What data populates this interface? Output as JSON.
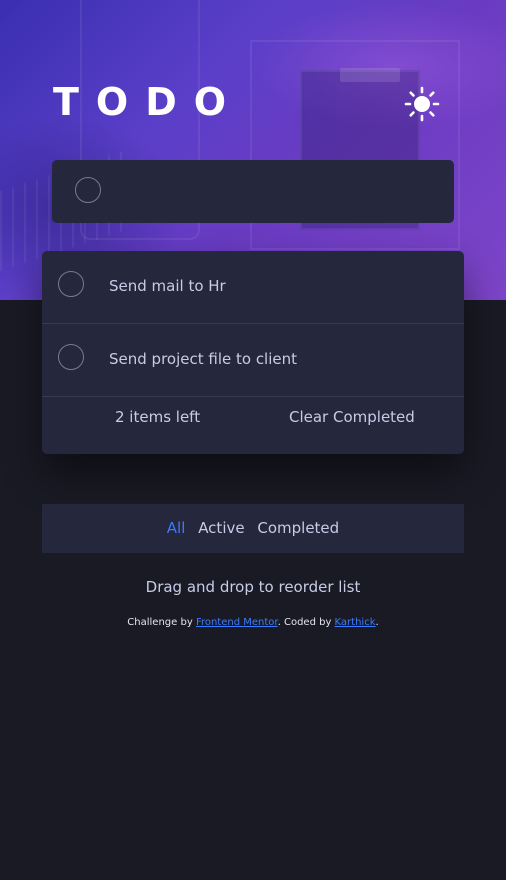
{
  "app": {
    "title": "TODO",
    "theme_icon": "sun-icon"
  },
  "new_todo": {
    "value": "",
    "placeholder": ""
  },
  "todos": [
    {
      "text": "Send mail to Hr",
      "completed": false
    },
    {
      "text": "Send project file to client",
      "completed": false
    }
  ],
  "list_footer": {
    "items_left": "2 items left",
    "clear_label": "Clear Completed"
  },
  "filters": {
    "all": "All",
    "active": "Active",
    "completed": "Completed",
    "selected": "All"
  },
  "hint": "Drag and drop to reorder list",
  "attribution": {
    "prefix": "Challenge by",
    "link1": "Frontend Mentor",
    "middle": ". Coded by",
    "link2": "Karthick",
    "suffix": "."
  },
  "colors": {
    "accent": "#3a7bfd",
    "card": "#25273c",
    "background": "#191a24"
  }
}
